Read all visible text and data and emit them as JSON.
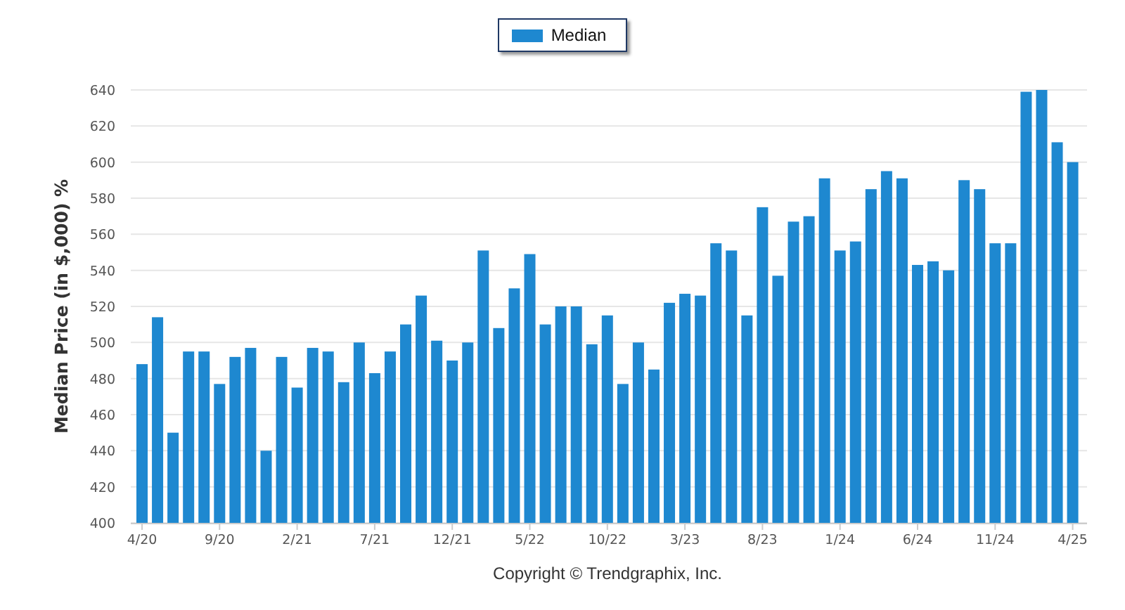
{
  "chart": {
    "chart_data": {
      "type": "bar",
      "ylabel": "Median Price (in $,000) %",
      "categories": [
        "4/20",
        null,
        null,
        null,
        null,
        "9/20",
        null,
        null,
        null,
        null,
        "2/21",
        null,
        null,
        null,
        null,
        "7/21",
        null,
        null,
        null,
        null,
        "12/21",
        null,
        null,
        null,
        null,
        "5/22",
        null,
        null,
        null,
        null,
        "10/22",
        null,
        null,
        null,
        null,
        "3/23",
        null,
        null,
        null,
        null,
        "8/23",
        null,
        null,
        null,
        null,
        "1/24",
        null,
        null,
        null,
        null,
        "6/24",
        null,
        null,
        null,
        null,
        "11/24",
        null,
        null,
        null,
        null,
        "4/25"
      ],
      "series": [
        {
          "name": "Median",
          "color": "#1e88d0",
          "values": [
            488,
            514,
            450,
            495,
            495,
            477,
            492,
            497,
            440,
            492,
            475,
            497,
            495,
            478,
            500,
            483,
            495,
            510,
            526,
            501,
            490,
            500,
            551,
            508,
            530,
            549,
            510,
            520,
            520,
            499,
            515,
            477,
            500,
            485,
            522,
            527,
            526,
            555,
            551,
            515,
            575,
            537,
            567,
            570,
            591,
            551,
            556,
            585,
            595,
            591,
            543,
            545,
            540,
            590,
            585,
            555,
            555,
            639,
            640,
            611,
            600
          ]
        }
      ],
      "ylim": [
        400,
        640
      ],
      "grid": true,
      "yticks": [
        400,
        420,
        440,
        460,
        480,
        500,
        520,
        540,
        560,
        580,
        600,
        620,
        640
      ]
    }
  },
  "footer": {
    "copyright": "Copyright © Trendgraphix, Inc."
  }
}
